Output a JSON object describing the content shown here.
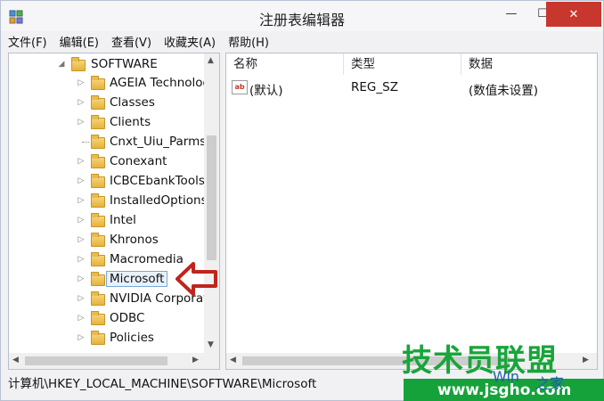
{
  "window": {
    "title": "注册表编辑器",
    "controls": {
      "minimize": "—",
      "maximize": "☐",
      "close": "✕"
    }
  },
  "menu": [
    "文件(F)",
    "编辑(E)",
    "查看(V)",
    "收藏夹(A)",
    "帮助(H)"
  ],
  "tree": {
    "root": "SOFTWARE",
    "items": [
      "AGEIA Technologies",
      "Classes",
      "Clients",
      "Cnxt_Uiu_Parms",
      "Conexant",
      "ICBCEbankTools",
      "InstalledOptions",
      "Intel",
      "Khronos",
      "Macromedia",
      "Microsoft",
      "NVIDIA Corporation",
      "ODBC",
      "Policies"
    ],
    "selected": "Microsoft"
  },
  "list": {
    "columns": [
      "名称",
      "类型",
      "数据"
    ],
    "rows": [
      {
        "name": "(默认)",
        "type": "REG_SZ",
        "data": "(数值未设置)",
        "icon": "string-value-icon"
      }
    ]
  },
  "status": "计算机\\HKEY_LOCAL_MACHINE\\SOFTWARE\\Microsoft",
  "annotation": {
    "color": "#c0241c",
    "icon": "arrow-left-icon"
  },
  "watermark": {
    "title": "技术员联盟",
    "url": "www.jsgho.com",
    "win": "Win",
    "site": "之家",
    "color": "#19a53a"
  }
}
